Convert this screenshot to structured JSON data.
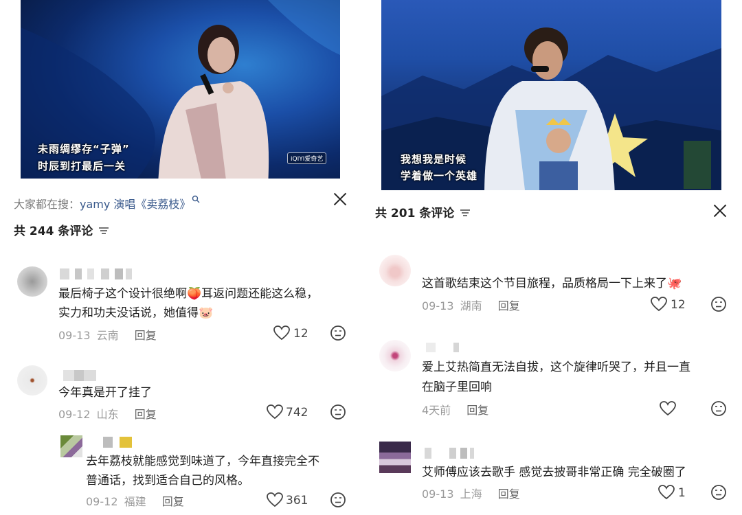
{
  "left": {
    "subtitle_line1": "未雨绸缪存“子弹”",
    "subtitle_line2": "时辰到打最后一关",
    "watermark": "iQIYI爱奇艺",
    "search_prefix": "大家都在搜：",
    "search_query": "yamy 演唱《卖荔枝》",
    "comment_count": "共 244 条评论",
    "comments": [
      {
        "line1": "最后椅子这个设计很绝啊🍑耳返问题还能这么稳，",
        "line2": "实力和功夫没话说，她值得🐷",
        "date": "09-13",
        "location": "云南",
        "reply": "回复",
        "likes": "12"
      },
      {
        "line1": "今年真是开了挂了",
        "date": "09-12",
        "location": "山东",
        "reply": "回复",
        "likes": "742"
      },
      {
        "line1": "去年荔枝就能感觉到味道了，今年直接完全不",
        "line2": "普通话，找到适合自己的风格。",
        "date": "09-12",
        "location": "福建",
        "reply": "回复",
        "likes": "361"
      }
    ]
  },
  "right": {
    "subtitle_line1": "我想我是时候",
    "subtitle_line2": "学着做一个英雄",
    "comment_count": "共 201 条评论",
    "comments": [
      {
        "line1": "这首歌结束这个节目旅程，品质格局一下上来了🐙",
        "date": "09-13",
        "location": "湖南",
        "reply": "回复",
        "likes": "12"
      },
      {
        "line1": "爱上艾热简直无法自拔，这个旋律听哭了，并且一直",
        "line2": "在脑子里回响",
        "date": "4天前",
        "reply": "回复",
        "likes": ""
      },
      {
        "line1": "艾师傅应该去歌手 感觉去披哥非常正确 完全破圈了",
        "date": "09-13",
        "location": "上海",
        "reply": "回复",
        "likes": "1"
      }
    ]
  },
  "colors": {
    "stage_blue": "#1b4fa8",
    "stage_dark": "#06122e",
    "meta_grey": "#9a9a9a"
  }
}
